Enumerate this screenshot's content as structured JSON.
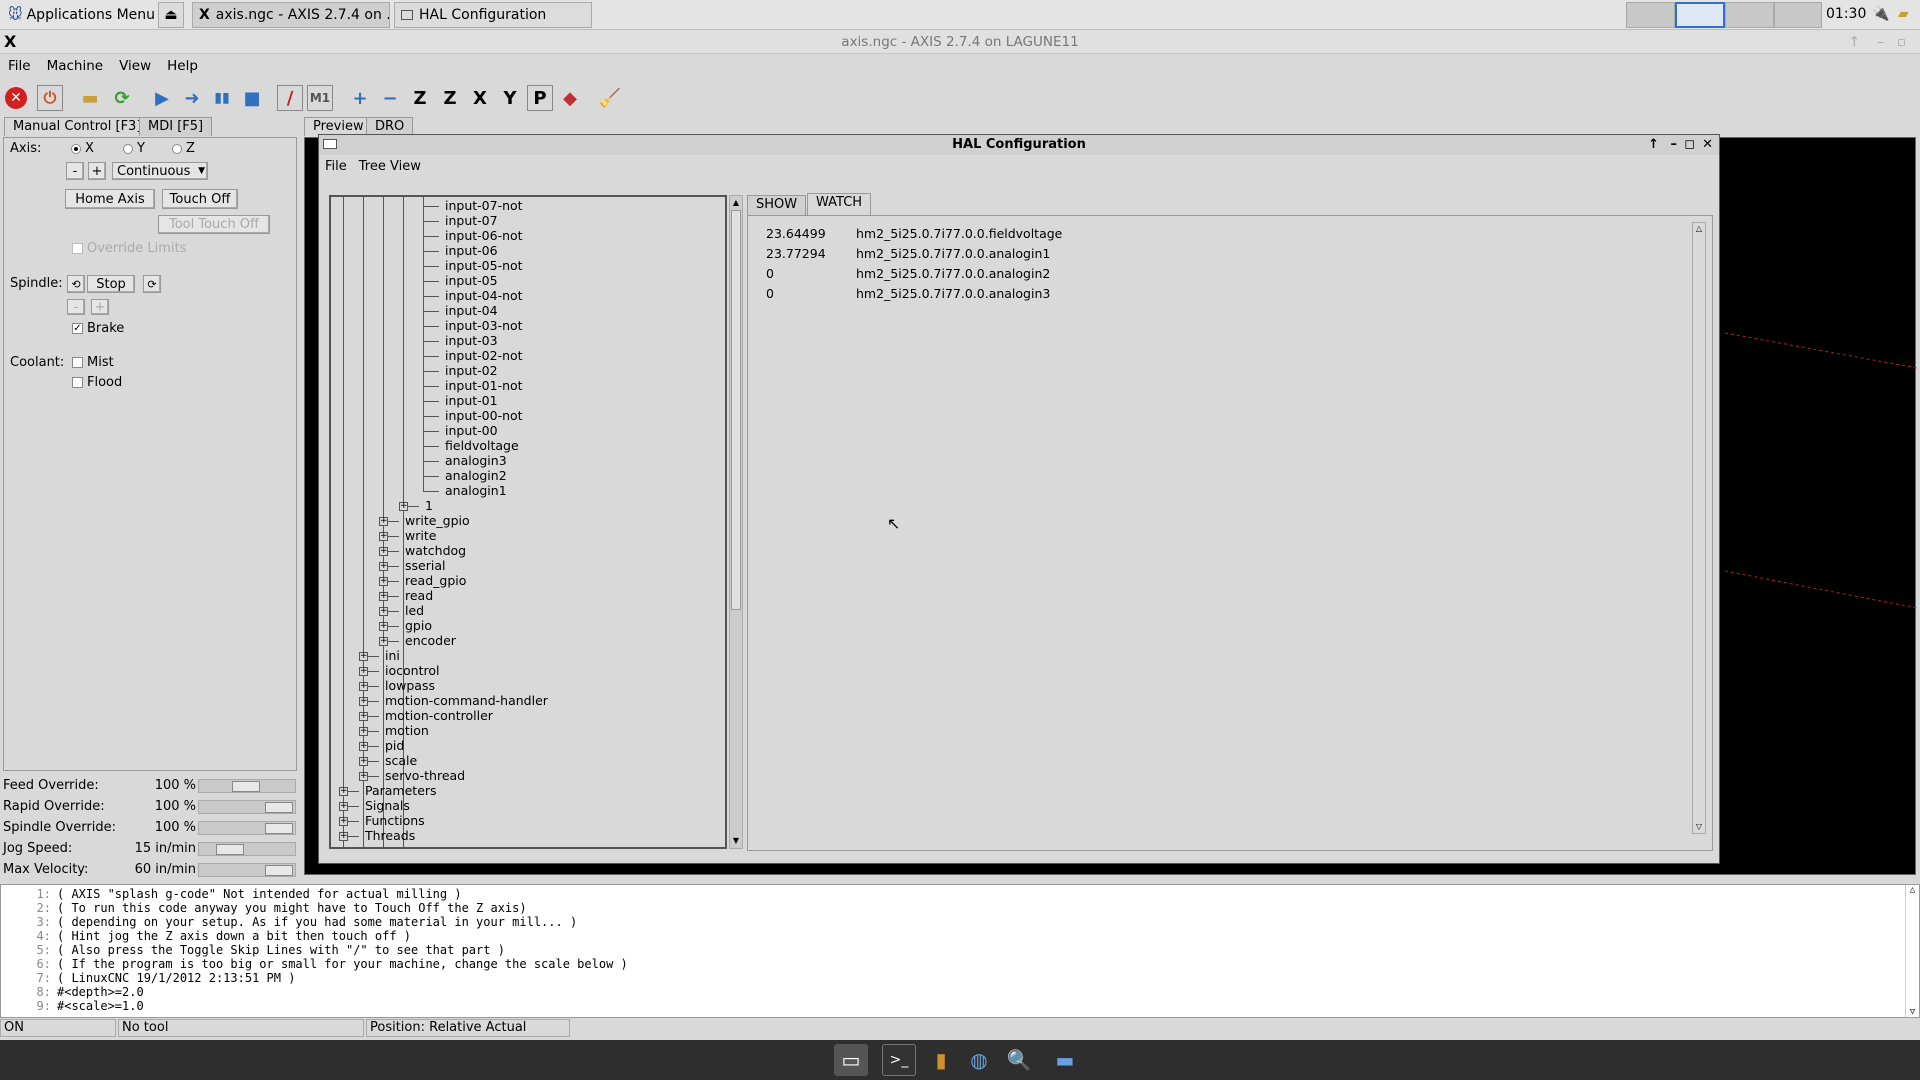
{
  "taskbar": {
    "apps_menu": "Applications Menu",
    "tasks": [
      "axis.ngc - AXIS 2.7.4 on ...",
      "HAL Configuration"
    ],
    "clock": "01:30"
  },
  "window": {
    "title": "axis.ngc - AXIS 2.7.4 on LAGUNE11",
    "x_logo": "X"
  },
  "menu": [
    "File",
    "Machine",
    "View",
    "Help"
  ],
  "tabs": {
    "manual": "Manual Control [F3]",
    "mdi": "MDI [F5]",
    "preview": "Preview",
    "dro": "DRO"
  },
  "manual": {
    "axis_label": "Axis:",
    "axes": [
      "X",
      "Y",
      "Z"
    ],
    "selected_axis": "X",
    "minus": "-",
    "plus": "+",
    "jog_mode": "Continuous",
    "home_axis": "Home Axis",
    "touch_off": "Touch Off",
    "tool_touch_off": "Tool Touch Off",
    "override_limits": "Override Limits",
    "spindle_label": "Spindle:",
    "spindle_stop": "Stop",
    "brake": "Brake",
    "coolant_label": "Coolant:",
    "mist": "Mist",
    "flood": "Flood"
  },
  "overrides": [
    {
      "label": "Feed Override:",
      "value": "100 %",
      "level": 0.5
    },
    {
      "label": "Rapid Override:",
      "value": "100 %",
      "level": 1.0
    },
    {
      "label": "Spindle Override:",
      "value": "100 %",
      "level": 1.0
    },
    {
      "label": "Jog Speed:",
      "value": "15 in/min",
      "level": 0.25
    },
    {
      "label": "Max Velocity:",
      "value": "60 in/min",
      "level": 1.0
    }
  ],
  "hal": {
    "title": "HAL Configuration",
    "menu": [
      "File",
      "Tree View"
    ],
    "tabs": [
      "SHOW",
      "WATCH"
    ],
    "tree_pins": [
      "input-07-not",
      "input-07",
      "input-06-not",
      "input-06",
      "input-05-not",
      "input-05",
      "input-04-not",
      "input-04",
      "input-03-not",
      "input-03",
      "input-02-not",
      "input-02",
      "input-01-not",
      "input-01",
      "input-00-not",
      "input-00",
      "fieldvoltage",
      "analogin3",
      "analogin2",
      "analogin1"
    ],
    "tree_sub1": "1",
    "tree_l2": [
      "write_gpio",
      "write",
      "watchdog",
      "sserial",
      "read_gpio",
      "read",
      "led",
      "gpio",
      "encoder"
    ],
    "tree_l1": [
      "ini",
      "iocontrol",
      "lowpass",
      "motion-command-handler",
      "motion-controller",
      "motion",
      "pid",
      "scale",
      "servo-thread"
    ],
    "tree_l0": [
      "Parameters",
      "Signals",
      "Functions",
      "Threads"
    ],
    "watch": [
      {
        "value": "23.64499",
        "name": "hm2_5i25.0.7i77.0.0.fieldvoltage"
      },
      {
        "value": "23.77294",
        "name": "hm2_5i25.0.7i77.0.0.analogin1"
      },
      {
        "value": "0",
        "name": "hm2_5i25.0.7i77.0.0.analogin2"
      },
      {
        "value": "0",
        "name": "hm2_5i25.0.7i77.0.0.analogin3"
      }
    ]
  },
  "gcode": [
    {
      "n": "1:",
      "t": "( AXIS \"splash g-code\" Not intended for actual milling )"
    },
    {
      "n": "2:",
      "t": "( To run this code anyway you might have to Touch Off the Z axis)"
    },
    {
      "n": "3:",
      "t": "( depending on your setup. As if you had some material in your mill... )"
    },
    {
      "n": "4:",
      "t": "( Hint jog the Z axis down a bit then touch off )"
    },
    {
      "n": "5:",
      "t": "( Also press the Toggle Skip Lines with \"/\" to see that part )"
    },
    {
      "n": "6:",
      "t": "( If the program is too big or small for your machine, change the scale below )"
    },
    {
      "n": "7:",
      "t": "( LinuxCNC 19/1/2012 2:13:51 PM )"
    },
    {
      "n": "8:",
      "t": "#<depth>=2.0"
    },
    {
      "n": "9:",
      "t": "#<scale>=1.0"
    }
  ],
  "status": {
    "state": "ON",
    "tool": "No tool",
    "position": "Position: Relative Actual"
  }
}
